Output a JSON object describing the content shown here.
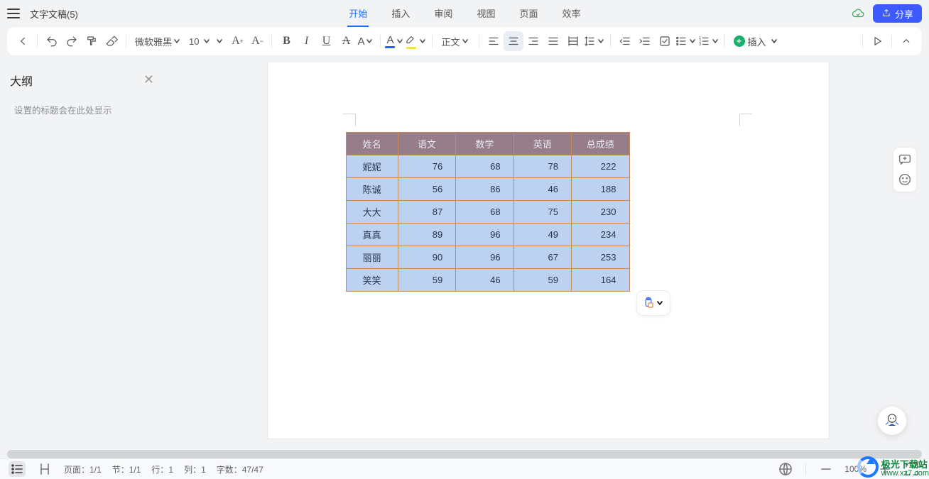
{
  "header": {
    "doc_title": "文字文稿(5)",
    "tabs": [
      "开始",
      "插入",
      "审阅",
      "视图",
      "页面",
      "效率"
    ],
    "active_tab": 0,
    "share_label": "分享"
  },
  "toolbar": {
    "font_name": "微软雅黑",
    "font_size": "10",
    "style_label": "正文",
    "insert_label": "插入",
    "icons": {
      "font_color": "#2462ff",
      "highlight_color": "#f2e24a"
    }
  },
  "sidebar": {
    "title": "大纲",
    "hint": "设置的标题会在此处显示"
  },
  "table": {
    "headers": [
      "姓名",
      "语文",
      "数学",
      "英语",
      "总成绩"
    ],
    "rows": [
      {
        "name": "妮妮",
        "vals": [
          76,
          68,
          78,
          222
        ]
      },
      {
        "name": "陈诚",
        "vals": [
          56,
          86,
          46,
          188
        ]
      },
      {
        "name": "大大",
        "vals": [
          87,
          68,
          75,
          230
        ]
      },
      {
        "name": "真真",
        "vals": [
          89,
          96,
          49,
          234
        ]
      },
      {
        "name": "丽丽",
        "vals": [
          90,
          96,
          67,
          253
        ]
      },
      {
        "name": "笑笑",
        "vals": [
          59,
          46,
          59,
          164
        ]
      }
    ]
  },
  "status": {
    "page": "页面：1/1",
    "section": "节：1/1",
    "row": "行：1",
    "col": "列：1",
    "words": "字数：47/47",
    "zoom": "100%"
  },
  "watermark": {
    "line1": "极光下载站",
    "line2": "www.xz7.com"
  }
}
